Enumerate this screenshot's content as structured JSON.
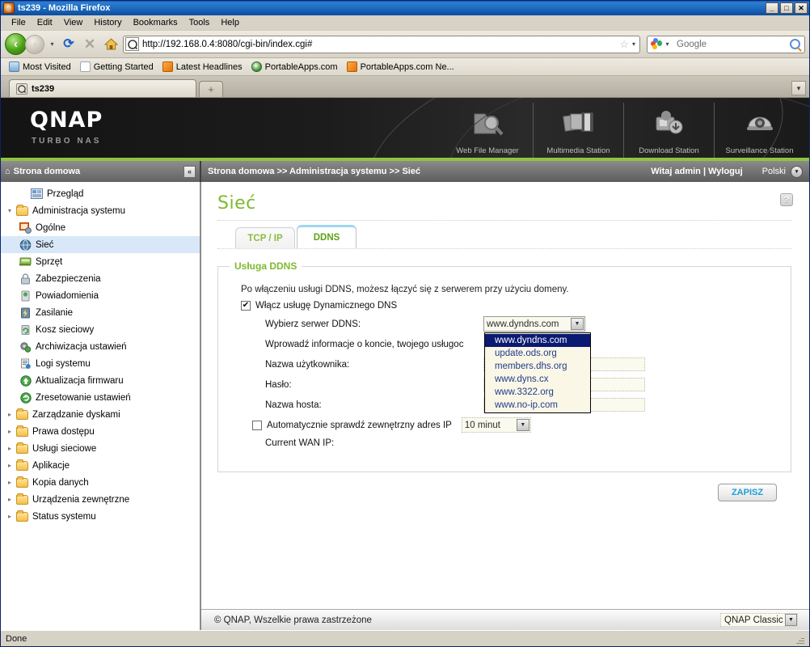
{
  "browser": {
    "window_title": "ts239 - Mozilla Firefox",
    "win_minimize": "_",
    "win_maximize": "□",
    "win_close": "✕",
    "menus": [
      "File",
      "Edit",
      "View",
      "History",
      "Bookmarks",
      "Tools",
      "Help"
    ],
    "nav": {
      "back": "‹",
      "forward": "›",
      "history_drop": "▾",
      "reload": "⟳",
      "stop": "✕",
      "home": "⌂",
      "identity_icon": "site-identity",
      "url": "http://192.168.0.4:8080/cgi-bin/index.cgi#",
      "bookmark_star": "☆",
      "url_drop": "▾"
    },
    "search": {
      "placeholder": "Google",
      "engine": "Google",
      "drop": "▾",
      "icon": "magnifier"
    },
    "bookmarks": [
      {
        "label": "Most Visited",
        "icon": "folder"
      },
      {
        "label": "Getting Started",
        "icon": "page"
      },
      {
        "label": "Latest Headlines",
        "icon": "feed"
      },
      {
        "label": "PortableApps.com",
        "icon": "portableapps"
      },
      {
        "label": "PortableApps.com Ne...",
        "icon": "feed"
      }
    ],
    "tabs": [
      {
        "label": "ts239",
        "active": true
      }
    ],
    "new_tab": "+",
    "tab_list": "▾",
    "status_text": "Done"
  },
  "qnap": {
    "logo": "QNAP",
    "tagline": "TURBO NAS",
    "stations": [
      {
        "label": "Web File Manager",
        "icon": "folder-magnifier"
      },
      {
        "label": "Multimedia Station",
        "icon": "photos-film"
      },
      {
        "label": "Download Station",
        "icon": "download-box"
      },
      {
        "label": "Surveillance Station",
        "icon": "dome-camera"
      }
    ],
    "home_label": "Strona domowa",
    "collapse": "«",
    "breadcrumb": "Strona domowa >> Administracja systemu >> Sieć",
    "welcome": "Witaj admin | Wyloguj",
    "language": "Polski",
    "lang_drop": "▾",
    "accent_green": "#8dc63f"
  },
  "sidebar": {
    "items": [
      {
        "label": "Przegląd",
        "level": 1,
        "twisty": "",
        "icon": "overview",
        "selected": false
      },
      {
        "label": "Administracja systemu",
        "level": 1,
        "twisty": "▾",
        "icon": "folder",
        "selected": false
      },
      {
        "label": "Ogólne",
        "level": 2,
        "twisty": "",
        "icon": "general",
        "selected": false
      },
      {
        "label": "Sieć",
        "level": 2,
        "twisty": "",
        "icon": "network",
        "selected": true
      },
      {
        "label": "Sprzęt",
        "level": 2,
        "twisty": "",
        "icon": "hardware",
        "selected": false
      },
      {
        "label": "Zabezpieczenia",
        "level": 2,
        "twisty": "",
        "icon": "security-lock",
        "selected": false
      },
      {
        "label": "Powiadomienia",
        "level": 2,
        "twisty": "",
        "icon": "notification",
        "selected": false
      },
      {
        "label": "Zasilanie",
        "level": 2,
        "twisty": "",
        "icon": "power",
        "selected": false
      },
      {
        "label": "Kosz sieciowy",
        "level": 2,
        "twisty": "",
        "icon": "recycle-bin",
        "selected": false
      },
      {
        "label": "Archiwizacja ustawień",
        "level": 2,
        "twisty": "",
        "icon": "backup-settings",
        "selected": false
      },
      {
        "label": "Logi systemu",
        "level": 2,
        "twisty": "",
        "icon": "system-logs",
        "selected": false
      },
      {
        "label": "Aktualizacja firmwaru",
        "level": 2,
        "twisty": "",
        "icon": "firmware-update",
        "selected": false
      },
      {
        "label": "Zresetowanie ustawień",
        "level": 2,
        "twisty": "",
        "icon": "reset-settings",
        "selected": false
      },
      {
        "label": "Zarządzanie dyskami",
        "level": 1,
        "twisty": "▸",
        "icon": "folder",
        "selected": false
      },
      {
        "label": "Prawa dostępu",
        "level": 1,
        "twisty": "▸",
        "icon": "folder",
        "selected": false
      },
      {
        "label": "Usługi sieciowe",
        "level": 1,
        "twisty": "▸",
        "icon": "folder",
        "selected": false
      },
      {
        "label": "Aplikacje",
        "level": 1,
        "twisty": "▸",
        "icon": "folder",
        "selected": false
      },
      {
        "label": "Kopia danych",
        "level": 1,
        "twisty": "▸",
        "icon": "folder",
        "selected": false
      },
      {
        "label": "Urządzenia zewnętrzne",
        "level": 1,
        "twisty": "▸",
        "icon": "folder",
        "selected": false
      },
      {
        "label": "Status systemu",
        "level": 1,
        "twisty": "▸",
        "icon": "folder",
        "selected": false
      }
    ]
  },
  "main": {
    "title": "Sieć",
    "help": "?",
    "tabs": [
      {
        "label": "TCP / IP",
        "active": false
      },
      {
        "label": "DDNS",
        "active": true
      }
    ],
    "fieldset_legend": "Usługa DDNS",
    "description": "Po włączeniu usługi DDNS, możesz łączyć się z serwerem przy użyciu domeny.",
    "enable_checkbox": {
      "label": "Włącz usługę Dynamicznego DNS",
      "checked": true,
      "mark": "✔"
    },
    "server_label": "Wybierz serwer DDNS:",
    "server_value": "www.dyndns.com",
    "server_arrow": "▼",
    "account_info_label": "Wprowadź informacje o koncie, twojego usługoc",
    "username_label": "Nazwa użytkownika:",
    "username_value": "",
    "password_label": "Hasło:",
    "password_value": "",
    "hostname_label": "Nazwa hosta:",
    "hostname_value": "",
    "autocheck": {
      "label": "Automatycznie sprawdź zewnętrzny adres IP",
      "checked": false,
      "mark": ""
    },
    "interval_value": "10 minut",
    "interval_arrow": "▼",
    "wan_label": "Current WAN IP:",
    "save_button": "ZAPISZ",
    "dropdown_options": [
      {
        "label": "www.dyndns.com",
        "selected": true
      },
      {
        "label": "update.ods.org",
        "selected": false
      },
      {
        "label": "members.dhs.org",
        "selected": false
      },
      {
        "label": "www.dyns.cx",
        "selected": false
      },
      {
        "label": "www.3322.org",
        "selected": false
      },
      {
        "label": "www.no-ip.com",
        "selected": false
      }
    ]
  },
  "footer": {
    "copyright": "© QNAP, Wszelkie prawa zastrzeżone",
    "theme": "QNAP Classic",
    "theme_arrow": "▼"
  }
}
